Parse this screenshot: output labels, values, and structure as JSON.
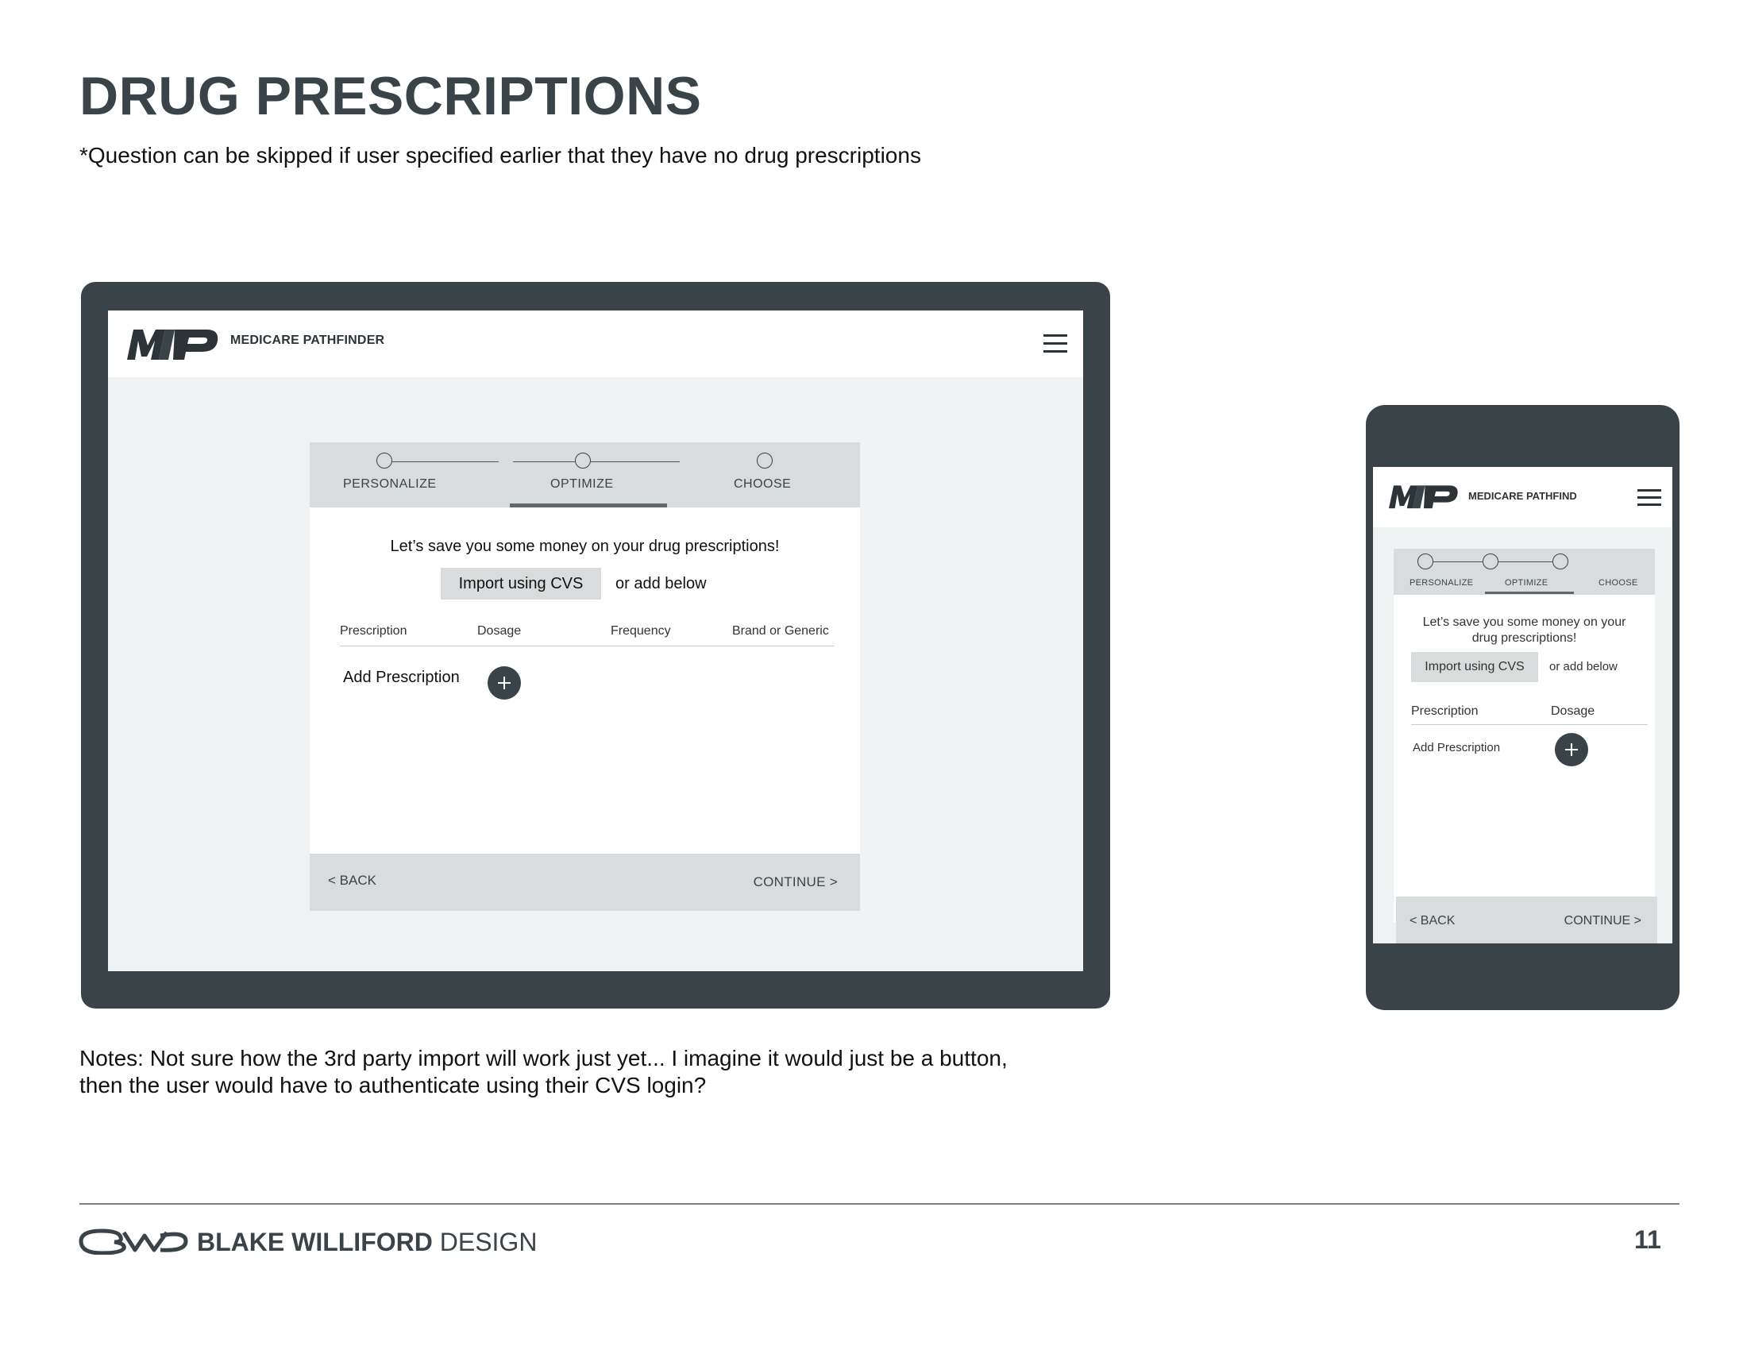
{
  "page": {
    "title": "DRUG PRESCRIPTIONS",
    "subtitle": "*Question can be skipped if user specified earlier that they have no drug prescriptions",
    "notes_line1": "Notes:  Not sure how the 3rd party import will work just yet... I imagine it would just be a button,",
    "notes_line2": "then the user would have to authenticate using their CVS login?",
    "page_number": "11"
  },
  "brand": {
    "name_bold": "BLAKE WILLIFORD",
    "name_regular": " DESIGN",
    "logo_icon": "bw-logo-icon"
  },
  "desktop": {
    "site_name": "MEDICARE PATHFINDER",
    "logo_icon": "mp-logo-icon",
    "menu_icon": "hamburger-icon",
    "steps": [
      {
        "label": "PERSONALIZE"
      },
      {
        "label": "OPTIMIZE"
      },
      {
        "label": "CHOOSE"
      }
    ],
    "active_step": "OPTIMIZE",
    "heading": "Let’s save you some money on your drug prescriptions!",
    "import_button": "Import using CVS",
    "or_text": "or add below",
    "columns": [
      "Prescription",
      "Dosage",
      "Frequency",
      "Brand or Generic"
    ],
    "add_label": "Add Prescription",
    "add_icon": "plus-icon",
    "back": "< BACK",
    "continue": "CONTINUE >"
  },
  "mobile": {
    "site_name": "MEDICARE PATHFIND",
    "steps": [
      {
        "label": "PERSONALIZE"
      },
      {
        "label": "OPTIMIZE"
      },
      {
        "label": "CHOOSE"
      }
    ],
    "heading": "Let’s save you some money on your drug prescriptions!",
    "import_button": "Import using CVS",
    "or_text": "or add below",
    "columns": [
      "Prescription",
      "Dosage"
    ],
    "add_label": "Add Prescription",
    "back": "< BACK",
    "continue": "CONTINUE >"
  },
  "colors": {
    "frame": "#3a4448",
    "panel": "#d8dcdc",
    "screen_bg": "#eff3f3"
  }
}
